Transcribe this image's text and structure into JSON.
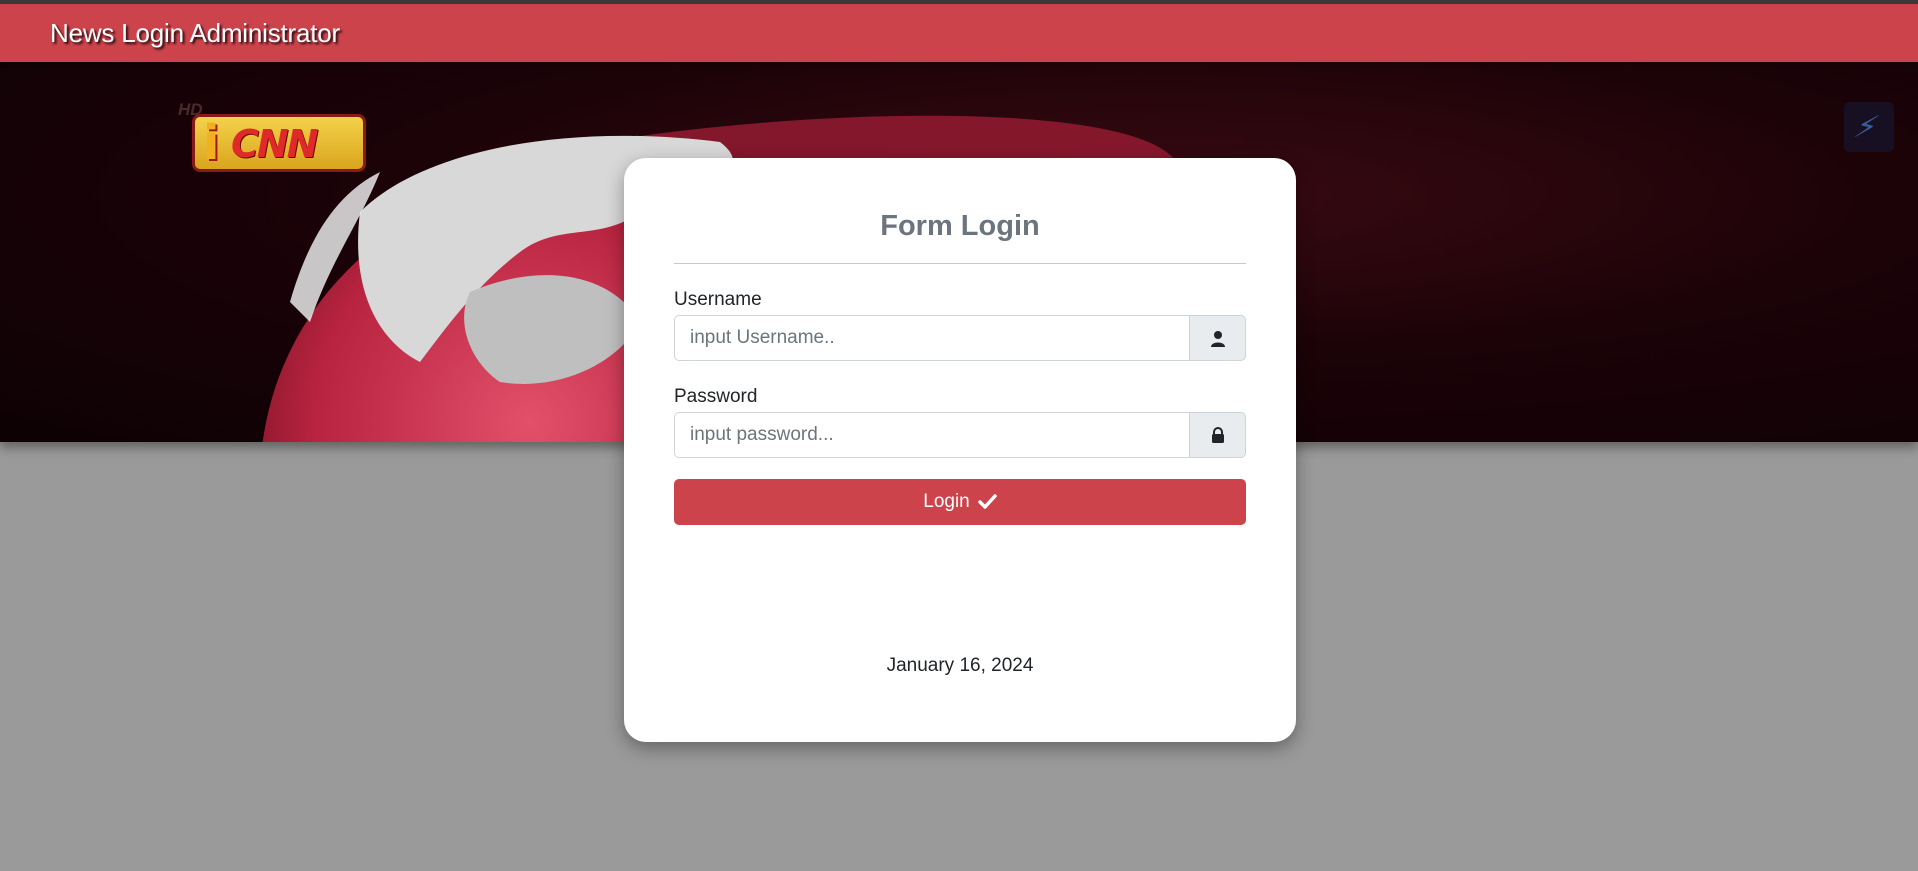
{
  "navbar": {
    "title": "News Login Administrator"
  },
  "banner": {
    "logo_hd": "HD",
    "logo_i": "i",
    "logo_text": "CNN"
  },
  "form": {
    "title": "Form Login",
    "username_label": "Username",
    "username_placeholder": "input Username..",
    "username_value": "",
    "password_label": "Password",
    "password_placeholder": "input password...",
    "password_value": "",
    "login_label": "Login"
  },
  "footer": {
    "date": "January 16, 2024"
  },
  "icons": {
    "username": "user-icon",
    "password": "lock-icon",
    "login": "check-icon",
    "corner": "lightning-icon"
  },
  "colors": {
    "accent": "#cc434b",
    "page_background": "#9a9a9a",
    "card": "#ffffff",
    "title_text": "#6c757d"
  }
}
